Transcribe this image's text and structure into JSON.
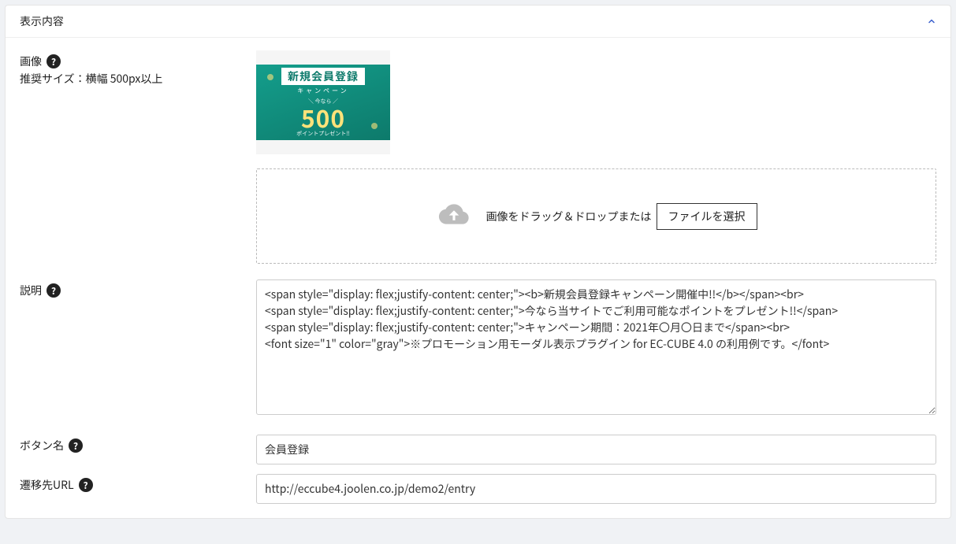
{
  "card": {
    "title": "表示内容"
  },
  "image": {
    "label": "画像",
    "recommend": "推奨サイズ：横幅 500px以上",
    "banner": {
      "topline": "新規会員登録",
      "subline": "キャンペーン",
      "midnote": "＼ 今なら ／",
      "bignum": "500",
      "bottomnote": "ポイントプレゼント!!"
    },
    "drop_text": "画像をドラッグ＆ドロップまたは",
    "file_button": "ファイルを選択"
  },
  "description": {
    "label": "説明",
    "value": "<span style=\"display: flex;justify-content: center;\"><b>新規会員登録キャンペーン開催中!!</b></span><br>\n<span style=\"display: flex;justify-content: center;\">今なら当サイトでご利用可能なポイントをプレゼント!!</span>\n<span style=\"display: flex;justify-content: center;\">キャンペーン期間：2021年〇月〇日まで</span><br>\n<font size=\"1\" color=\"gray\">※プロモーション用モーダル表示プラグイン for EC-CUBE 4.0 の利用例です。</font>"
  },
  "button_name": {
    "label": "ボタン名",
    "value": "会員登録"
  },
  "target_url": {
    "label": "遷移先URL",
    "value": "http://eccube4.joolen.co.jp/demo2/entry"
  }
}
